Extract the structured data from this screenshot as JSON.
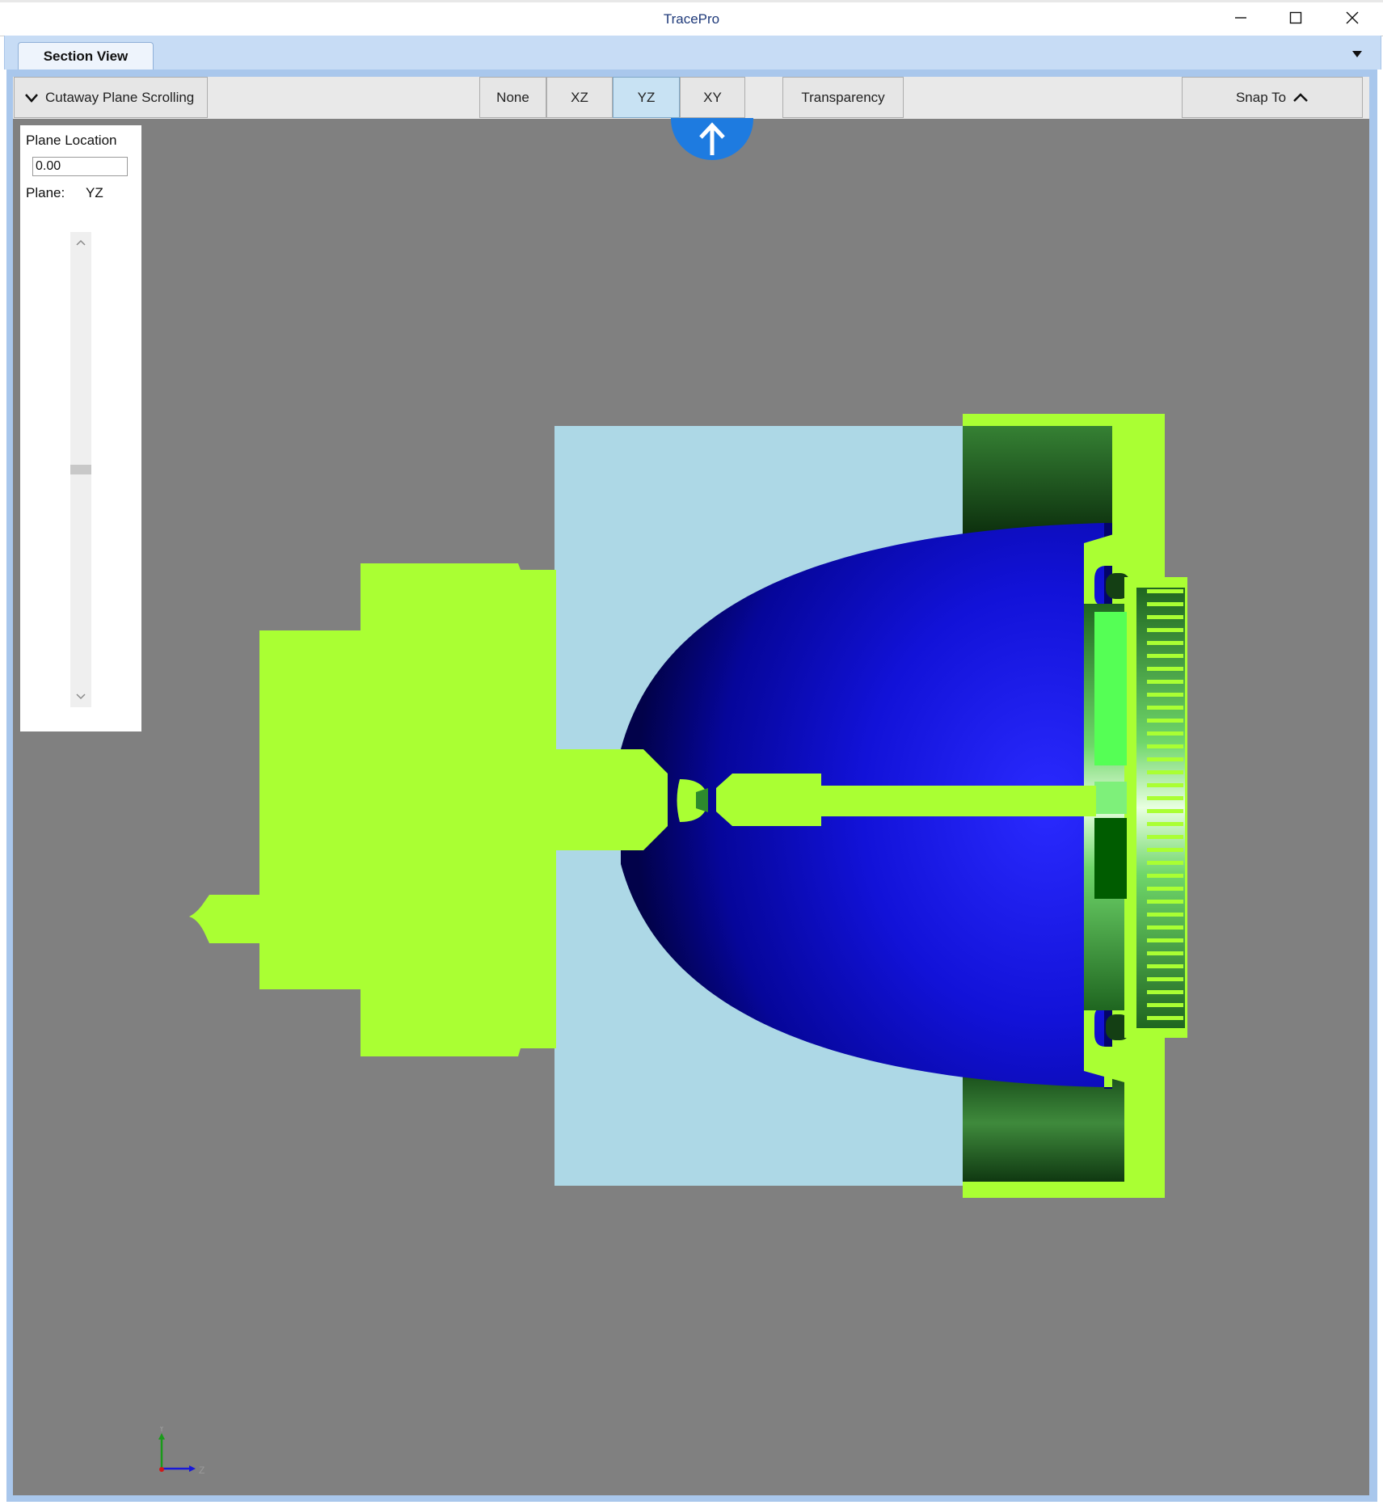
{
  "window": {
    "title": "TracePro"
  },
  "tabs": [
    {
      "label": "Section View",
      "active": true
    }
  ],
  "toolbar": {
    "cutaway_label": "Cutaway Plane Scrolling",
    "plane_buttons": [
      "None",
      "XZ",
      "YZ",
      "XY"
    ],
    "active_plane": "YZ",
    "transparency_label": "Transparency",
    "snap_label": "Snap To"
  },
  "plane_panel": {
    "location_label": "Plane Location",
    "location_value": "0.00",
    "plane_label": "Plane:",
    "plane_value": "YZ",
    "slider_position": 0.5
  },
  "axis_triad": {
    "y_label": "Y",
    "z_label": "Z"
  },
  "colors": {
    "viewport_bg": "#808080",
    "housing_green": "#aaff33",
    "reflector_blue": "#1010d0",
    "cover_lightblue": "#add8e6",
    "accent_blue": "#1e7be0"
  },
  "icons": {
    "cutaway": "chevron-down-icon",
    "snap": "chevron-up-icon",
    "up_arrow": "arrow-up-icon",
    "minimize": "minimize-icon",
    "maximize": "maximize-icon",
    "close": "close-icon"
  }
}
